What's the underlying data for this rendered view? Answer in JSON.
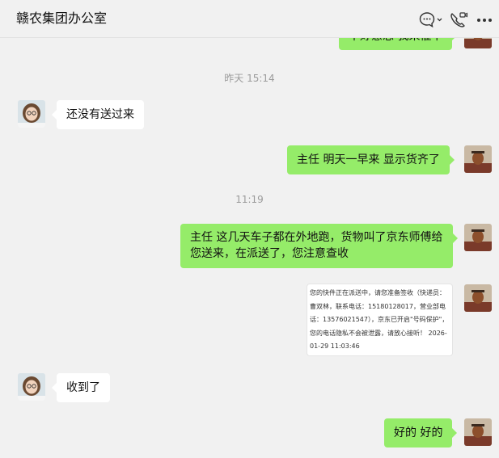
{
  "header": {
    "title": "赣农集团办公室",
    "icons": [
      "chat-bubble-icon",
      "video-call-icon",
      "more-icon"
    ]
  },
  "messages": [
    {
      "side": "right",
      "text": "不好意思 我来催下",
      "partial": true
    },
    {
      "type": "time",
      "text": "昨天 15:14"
    },
    {
      "side": "left",
      "text": "还没有送过来"
    },
    {
      "side": "right",
      "text": "主任  明天一早来 显示货齐了"
    },
    {
      "type": "time",
      "text": "11:19"
    },
    {
      "side": "right",
      "text": "主任 这几天车子都在外地跑，货物叫了京东师傅给您送来，在派送了，您注意查收"
    },
    {
      "side": "right",
      "type": "image",
      "image_text": "您的快件正在派送中，请您准备签收（快递员：曹双林，联系电话：15180128017，营业部电话：13576021547），京东已开启\"号码保护\"，您的电话隐私不会被泄露，请放心接听！ 2026-01-29 11:03:46"
    },
    {
      "side": "left",
      "text": "收到了"
    },
    {
      "side": "right",
      "text": "好的 好的"
    }
  ],
  "colors": {
    "background": "#f1f1f1",
    "outgoing_bubble": "#95ec69",
    "incoming_bubble": "#ffffff",
    "timestamp_text": "#9b9b9b"
  }
}
